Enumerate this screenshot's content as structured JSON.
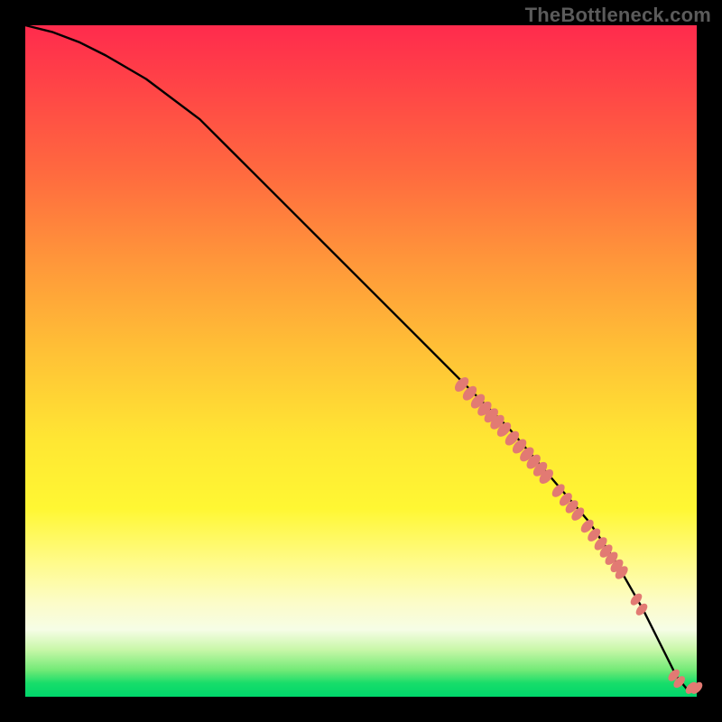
{
  "watermark": "TheBottleneck.com",
  "colors": {
    "dot": "#e27a73",
    "curve": "#000000"
  },
  "chart_data": {
    "type": "line",
    "title": "",
    "xlabel": "",
    "ylabel": "",
    "xlim": [
      0,
      100
    ],
    "ylim": [
      0,
      100
    ],
    "grid": false,
    "legend": false,
    "series": [
      {
        "name": "bottleneck-curve",
        "type": "line",
        "x": [
          0,
          4,
          8,
          12,
          18,
          26,
          34,
          42,
          50,
          58,
          66,
          72,
          78,
          84,
          88,
          92,
          95,
          97,
          98.5,
          100
        ],
        "y": [
          100,
          99,
          97.5,
          95.5,
          92,
          86,
          78,
          70,
          62,
          54,
          46,
          40,
          33,
          26,
          20,
          13,
          7,
          3,
          1.2,
          1.2
        ]
      },
      {
        "name": "highlighted-points",
        "type": "scatter",
        "points": [
          {
            "x": 65.0,
            "y": 46.5,
            "r": 1.1
          },
          {
            "x": 66.2,
            "y": 45.2,
            "r": 1.1
          },
          {
            "x": 67.4,
            "y": 44.0,
            "r": 1.1
          },
          {
            "x": 68.4,
            "y": 42.9,
            "r": 1.1
          },
          {
            "x": 69.4,
            "y": 41.9,
            "r": 1.1
          },
          {
            "x": 70.3,
            "y": 40.9,
            "r": 1.1
          },
          {
            "x": 71.3,
            "y": 39.8,
            "r": 1.1
          },
          {
            "x": 72.5,
            "y": 38.5,
            "r": 1.1
          },
          {
            "x": 73.6,
            "y": 37.3,
            "r": 1.1
          },
          {
            "x": 74.7,
            "y": 36.1,
            "r": 1.1
          },
          {
            "x": 75.7,
            "y": 35.0,
            "r": 1.1
          },
          {
            "x": 76.7,
            "y": 33.9,
            "r": 1.1
          },
          {
            "x": 77.6,
            "y": 32.8,
            "r": 1.1
          },
          {
            "x": 79.4,
            "y": 30.7,
            "r": 1.0
          },
          {
            "x": 80.5,
            "y": 29.4,
            "r": 1.0
          },
          {
            "x": 81.4,
            "y": 28.3,
            "r": 1.0
          },
          {
            "x": 82.3,
            "y": 27.2,
            "r": 1.0
          },
          {
            "x": 83.7,
            "y": 25.4,
            "r": 1.0
          },
          {
            "x": 84.7,
            "y": 24.1,
            "r": 1.0
          },
          {
            "x": 85.7,
            "y": 22.8,
            "r": 1.0
          },
          {
            "x": 86.5,
            "y": 21.7,
            "r": 1.0
          },
          {
            "x": 87.3,
            "y": 20.6,
            "r": 1.0
          },
          {
            "x": 88.1,
            "y": 19.5,
            "r": 1.0
          },
          {
            "x": 88.8,
            "y": 18.5,
            "r": 1.0
          },
          {
            "x": 91.0,
            "y": 14.5,
            "r": 0.9
          },
          {
            "x": 91.8,
            "y": 13.0,
            "r": 0.9
          },
          {
            "x": 96.6,
            "y": 3.2,
            "r": 0.9
          },
          {
            "x": 97.4,
            "y": 2.2,
            "r": 0.9
          },
          {
            "x": 99.2,
            "y": 1.3,
            "r": 0.9
          },
          {
            "x": 100.0,
            "y": 1.3,
            "r": 0.9
          }
        ]
      }
    ]
  }
}
